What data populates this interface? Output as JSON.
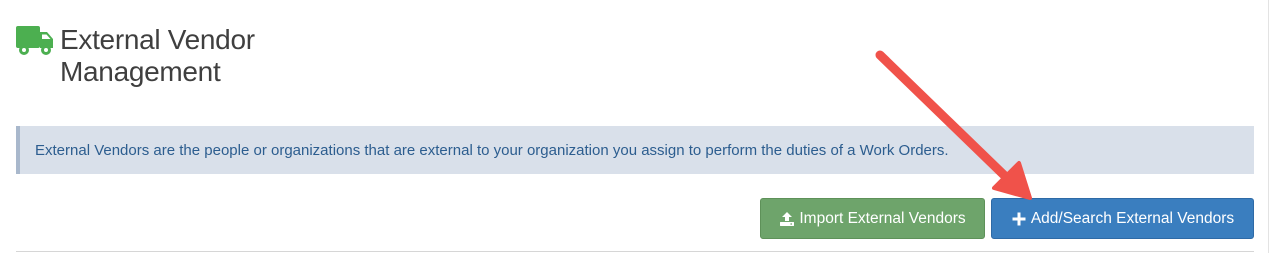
{
  "header": {
    "title": "External Vendor Management",
    "icon": "truck-icon",
    "icon_color": "#4caf50"
  },
  "info": {
    "text": "External Vendors are the people or organizations that are external to your organization you assign to perform the duties of a Work Orders."
  },
  "actions": {
    "import_label": "Import External Vendors",
    "import_icon": "upload-icon",
    "import_color": "#6ea46b",
    "add_label": "Add/Search External Vendors",
    "add_icon": "plus-icon",
    "add_color": "#3a7ebf"
  },
  "annotation": {
    "arrow_color": "#f0524a"
  }
}
